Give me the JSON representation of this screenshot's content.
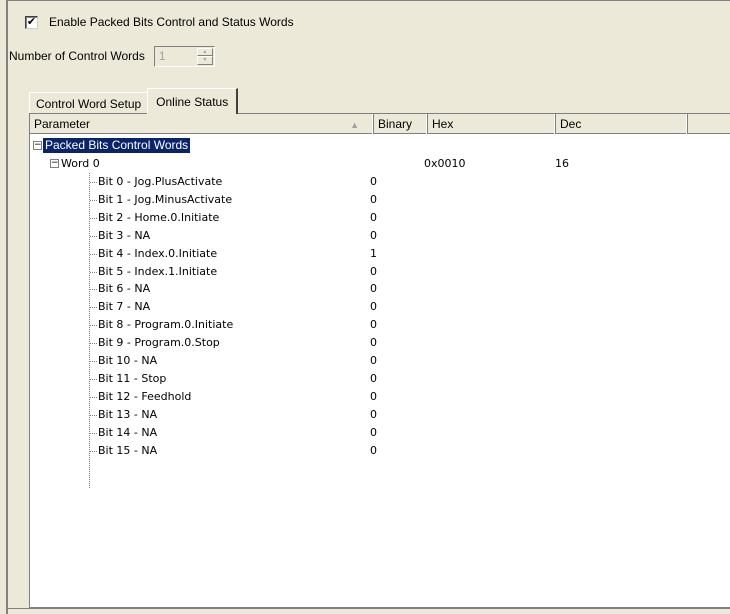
{
  "enable_checkbox": {
    "label": "Enable Packed Bits Control and Status Words",
    "checked_glyph": "✔"
  },
  "control_words": {
    "label": "Number of Control Words",
    "value": "1"
  },
  "tabs": [
    {
      "label": "Control Word Setup"
    },
    {
      "label": "Online Status"
    }
  ],
  "columns": {
    "parameter": "Parameter",
    "binary": "Binary",
    "hex": "Hex",
    "dec": "Dec"
  },
  "tree": {
    "root_label": "Packed Bits Control Words",
    "word_label": "Word 0",
    "word_hex": "0x0010",
    "word_dec": "16",
    "bits": [
      {
        "label": "Bit 0 - Jog.PlusActivate",
        "binary": "0"
      },
      {
        "label": "Bit 1 - Jog.MinusActivate",
        "binary": "0"
      },
      {
        "label": "Bit 2 - Home.0.Initiate",
        "binary": "0"
      },
      {
        "label": "Bit 3 - NA",
        "binary": "0"
      },
      {
        "label": "Bit 4 - Index.0.Initiate",
        "binary": "1"
      },
      {
        "label": "Bit 5 - Index.1.Initiate",
        "binary": "0"
      },
      {
        "label": "Bit 6 - NA",
        "binary": "0"
      },
      {
        "label": "Bit 7 - NA",
        "binary": "0"
      },
      {
        "label": "Bit 8 - Program.0.Initiate",
        "binary": "0"
      },
      {
        "label": "Bit 9 - Program.0.Stop",
        "binary": "0"
      },
      {
        "label": "Bit 10 - NA",
        "binary": "0"
      },
      {
        "label": "Bit 11 - Stop",
        "binary": "0"
      },
      {
        "label": "Bit 12 - Feedhold",
        "binary": "0"
      },
      {
        "label": "Bit 13 - NA",
        "binary": "0"
      },
      {
        "label": "Bit 14 - NA",
        "binary": "0"
      },
      {
        "label": "Bit 15 - NA",
        "binary": "0"
      }
    ]
  }
}
